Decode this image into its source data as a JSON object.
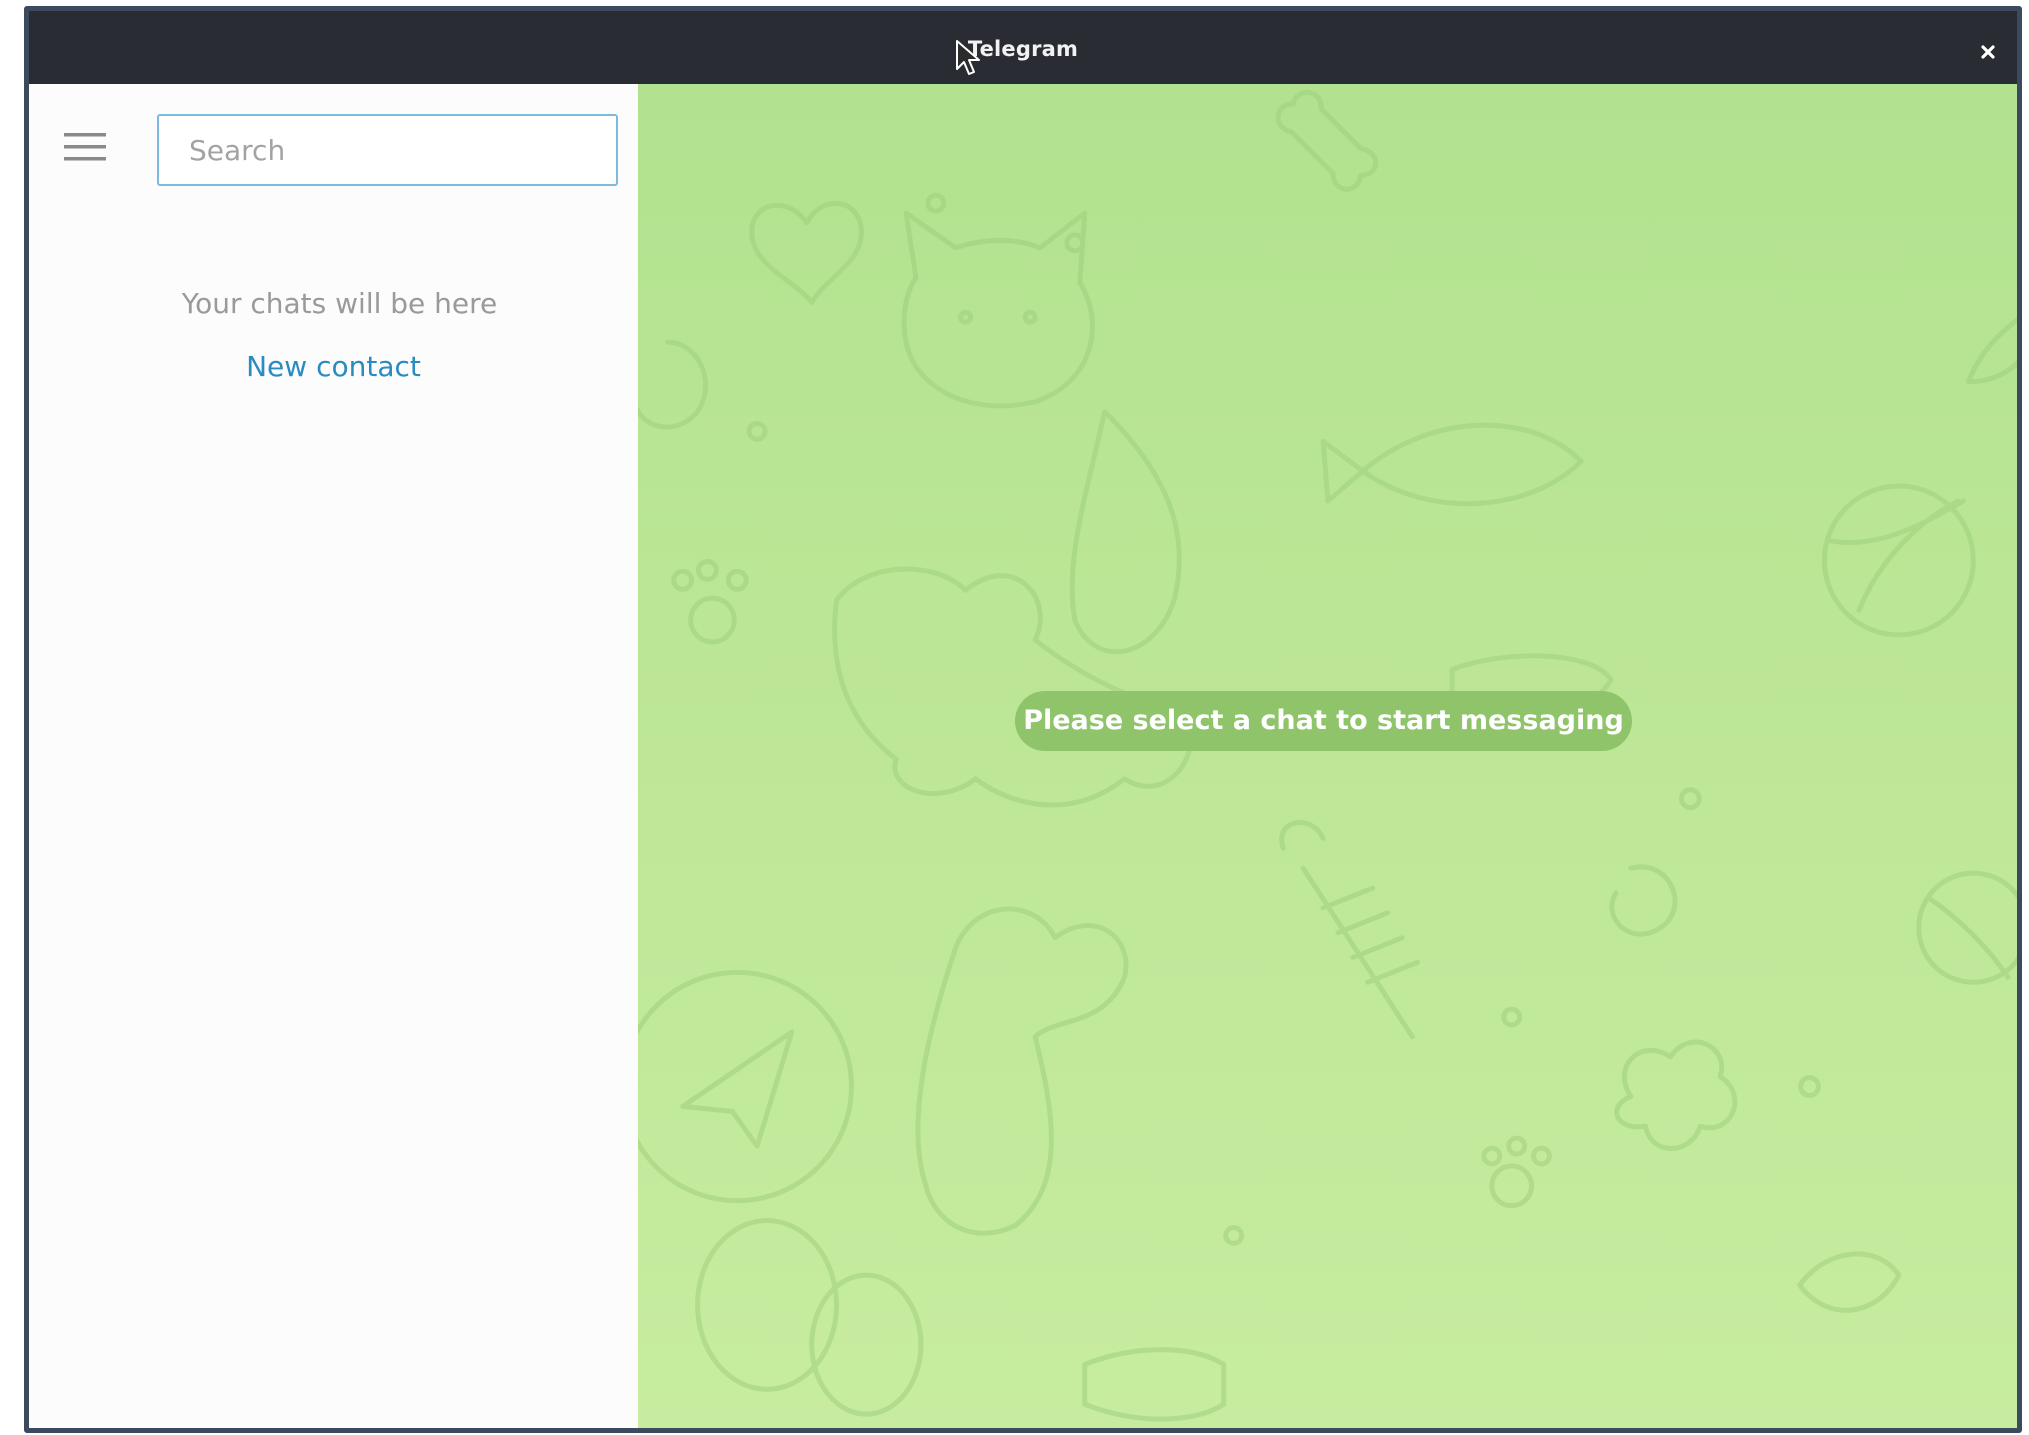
{
  "window": {
    "title": "Telegram",
    "close_label": "×"
  },
  "icons": {
    "menu": "hamburger-menu-icon",
    "close": "close-icon",
    "cursor": "mouse-pointer-icon"
  },
  "sidebar": {
    "search_placeholder": "Search",
    "search_value": "",
    "empty_message": "Your chats will be here",
    "new_contact_label": "New contact"
  },
  "chat": {
    "placeholder_message": "Please select a chat to start messaging"
  },
  "colors": {
    "titlebar": "#292d33",
    "sidebar_bg": "#fdfcfd",
    "chat_bg": "#b9e594",
    "link": "#2a8bc0",
    "pill": "#8fc46b",
    "search_border": "#7bbbe2"
  }
}
